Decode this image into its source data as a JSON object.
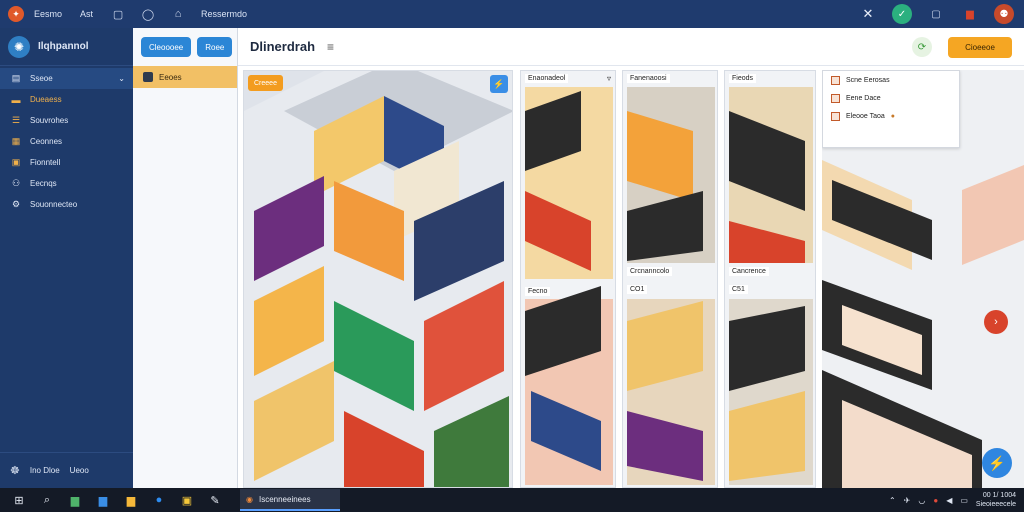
{
  "topbar": {
    "menus": [
      "Eesmo",
      "Ast",
      "Ressermdo"
    ],
    "right_icons": [
      "close-icon",
      "check-circle-icon",
      "square-icon",
      "flag-icon",
      "profile-icon"
    ]
  },
  "sidebar": {
    "title": "Ilqhpannol",
    "items": [
      {
        "label": "Sseoe",
        "icon": "grid-icon"
      },
      {
        "label": "Dueaess",
        "icon": "folder-icon"
      },
      {
        "label": "Souvrohes",
        "icon": "list-icon"
      },
      {
        "label": "Ceonnes",
        "icon": "chart-icon"
      },
      {
        "label": "Fionntell",
        "icon": "people-icon"
      },
      {
        "label": "Eecnqs",
        "icon": "users-icon"
      },
      {
        "label": "Souonnecteo",
        "icon": "settings-icon"
      }
    ],
    "footer": {
      "left": "Ino Dloe",
      "right": "Ueoo"
    }
  },
  "panel2": {
    "button1": "Cleoooee",
    "button2": "Roee",
    "selected": "Eeoes"
  },
  "main": {
    "title": "Dlinerdrah",
    "action_button": "Cioeeoe",
    "grid_badge": "Creeee",
    "cards": [
      {
        "label": "Enaonadeol",
        "sub_label": "Fecno"
      },
      {
        "label": "Fanenaoosi",
        "sub_label": "Crcnanncolo",
        "count": "CO1"
      },
      {
        "label": "Fieods",
        "sub_label": "Cancrence",
        "count": "C51"
      }
    ],
    "popup": [
      "Scne Eerosas",
      "Eene Dace",
      "Eleooe Taoa"
    ]
  },
  "taskbar": {
    "active_app": "Iscenneeinees",
    "time": "00 1/ 1004",
    "date": "Sieoieeecele"
  },
  "colors": {
    "topbar": "#1f3b6e",
    "sidebar": "#1e3a6a",
    "accent_orange": "#f5a623",
    "accent_blue": "#2b86d6",
    "taskbar": "#141a26"
  }
}
